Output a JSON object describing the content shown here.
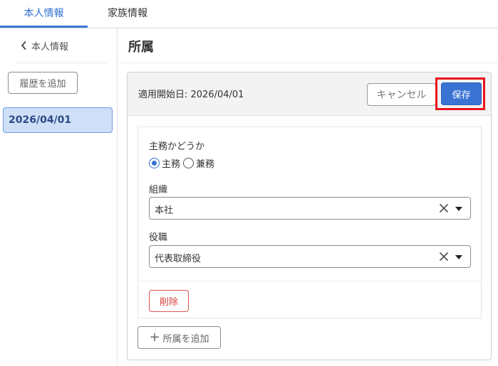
{
  "tabs": [
    {
      "label": "本人情報",
      "active": true
    },
    {
      "label": "家族情報",
      "active": false
    }
  ],
  "sidebar": {
    "back_label": "本人情報",
    "add_history_label": "履歴を追加",
    "history_items": [
      {
        "label": "2026/04/01",
        "selected": true
      }
    ]
  },
  "main": {
    "title": "所属",
    "start_date_label": "適用開始日: 2026/04/01",
    "cancel_label": "キャンセル",
    "save_label": "保存",
    "form": {
      "main_duty_label": "主務かどうか",
      "radio_main_label": "主務",
      "radio_sub_label": "兼務",
      "radio_selected": "主務",
      "org_label": "組織",
      "org_value": "本社",
      "position_label": "役職",
      "position_value": "代表取締役",
      "delete_label": "削除"
    },
    "add_affiliation_label": "所属を追加"
  },
  "colors": {
    "accent": "#3b73d4",
    "highlight_box": "#e8141b",
    "delete": "#d43f3a",
    "selected_bg": "#cfdff7"
  }
}
